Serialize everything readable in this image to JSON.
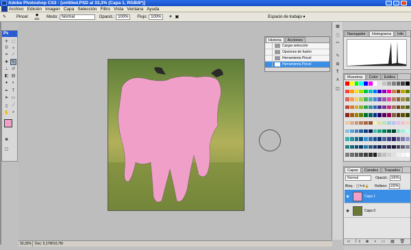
{
  "titlebar": {
    "title": "Adobe Photoshop CS3 - [untitled.PSD al 33,3% (Capa 1, RGB/8*)]"
  },
  "menu": [
    "Archivo",
    "Edición",
    "Imagen",
    "Capa",
    "Selección",
    "Filtro",
    "Vista",
    "Ventana",
    "Ayuda"
  ],
  "options": {
    "brush_label": "Pincel:",
    "brush_size": "201",
    "mode_label": "Modo:",
    "mode_value": "Normal",
    "opacity_label": "Opacid.:",
    "opacity_value": "100%",
    "flow_label": "Flujo:",
    "flow_value": "100%",
    "workspace": "Espacio de trabajo"
  },
  "toolbox": {
    "logo": "Ps"
  },
  "history": {
    "tabs": [
      "Historia",
      "Acciones"
    ],
    "items": [
      "Cargar selección",
      "Opciones de fusión",
      "Herramienta Pincel",
      "Herramienta Pincel"
    ]
  },
  "navigator": {
    "tabs": [
      "Navegador",
      "Histograma",
      "Info"
    ]
  },
  "swatches": {
    "tabs": [
      "Muestras",
      "Color",
      "Estilos"
    ],
    "colors": [
      "#ff0000",
      "#ffff00",
      "#00ff00",
      "#00ffff",
      "#0000ff",
      "#ff00ff",
      "#ffffff",
      "#e0e0e0",
      "#c0c0c0",
      "#a0a0a0",
      "#808080",
      "#606060",
      "#404040",
      "#000000",
      "#ff3b3b",
      "#ff9b00",
      "#ffe000",
      "#a0e000",
      "#00c040",
      "#00c0c0",
      "#0070ff",
      "#3000c0",
      "#9000c0",
      "#ff00a0",
      "#c08040",
      "#804000",
      "#c0a000",
      "#608000",
      "#e06060",
      "#f0a050",
      "#f0d060",
      "#b0d050",
      "#50b060",
      "#50b0b0",
      "#5080e0",
      "#6050b0",
      "#a050b0",
      "#e050a0",
      "#b08060",
      "#906040",
      "#a09040",
      "#708040",
      "#c04040",
      "#d08030",
      "#d0b030",
      "#90b030",
      "#30a050",
      "#309090",
      "#3060c0",
      "#403090",
      "#803090",
      "#c03080",
      "#a07050",
      "#704020",
      "#807020",
      "#506020",
      "#902020",
      "#a06010",
      "#a08000",
      "#608000",
      "#007030",
      "#006060",
      "#003090",
      "#200060",
      "#600060",
      "#900050",
      "#806040",
      "#503010",
      "#605000",
      "#304000",
      "#e8c8a8",
      "#d8b090",
      "#c89878",
      "#b88060",
      "#a86848",
      "#985030",
      "#f0f0c0",
      "#e0e0a0",
      "#c0e0c0",
      "#a0d0e0",
      "#c0c0f0",
      "#e0c0f0",
      "#f0c0d0",
      "#f0d0c0",
      "#80c0e0",
      "#60a0d0",
      "#4080c0",
      "#2060a0",
      "#104080",
      "#002060",
      "#40c0a0",
      "#20a080",
      "#008060",
      "#006040",
      "#004030",
      "#80e0c0",
      "#a0f0e0",
      "#c0fff0",
      "#3ab0b0",
      "#2a90a0",
      "#1a7090",
      "#0a5080",
      "#3a90d0",
      "#2a70b0",
      "#1a5090",
      "#0a3070",
      "#4a60a0",
      "#3a4080",
      "#2a2060",
      "#5a5a90",
      "#7a7ab0",
      "#9a9ad0",
      "#208080",
      "#186878",
      "#105070",
      "#083868",
      "#2878a8",
      "#205888",
      "#183868",
      "#102048",
      "#303868",
      "#282848",
      "#201838",
      "#404058",
      "#606078",
      "#808098",
      "#7f7f7f",
      "#6f6f6f",
      "#5f5f5f",
      "#4f4f4f",
      "#3f3f3f",
      "#2f2f2f",
      "#1f1f1f",
      "#afafaf",
      "#bfbfbf",
      "#cfcfcf",
      "#dfdfdf",
      "#efefef",
      "#f7f7f7",
      "#ffffff"
    ]
  },
  "layers": {
    "tabs": [
      "Capas",
      "Canales",
      "Trazados"
    ],
    "mode": "Normal",
    "opacity_label": "Opacid.:",
    "opacity_value": "100%",
    "lock_label": "Bloq.:",
    "fill_label": "Relleno:",
    "fill_value": "100%",
    "items": [
      {
        "name": "Capa 1",
        "selected": true
      },
      {
        "name": "Capa 0",
        "selected": false
      }
    ]
  },
  "status": {
    "zoom": "33,33%",
    "doc": "Doc: 5,17M/10,7M"
  }
}
